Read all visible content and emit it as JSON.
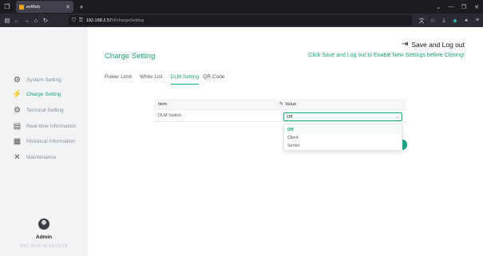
{
  "browser": {
    "tab_title": "evWeb",
    "new_tab": "+",
    "url_host": "192.168.2.57",
    "url_path": "/#/chargeSetting"
  },
  "sidebar": {
    "items": [
      {
        "label": "System Setting",
        "icon": "gear-icon"
      },
      {
        "label": "Charge Setting",
        "icon": "charging-icon"
      },
      {
        "label": "Terminal Setting",
        "icon": "terminal-icon"
      },
      {
        "label": "Real-time Information",
        "icon": "monitor-icon"
      },
      {
        "label": "Historical Information",
        "icon": "history-icon"
      },
      {
        "label": "Maintenance",
        "icon": "tools-icon"
      }
    ],
    "user": "Admin",
    "mac": "MAC:00:0F:8F:F5:CE:6A"
  },
  "header": {
    "title": "Charge Setting",
    "save_logout": "Save and Log out",
    "hint": "Click Save and Log out to Enable New Settings before Closing!"
  },
  "tabs": [
    "Power Limit",
    "White List",
    "DLM Setting",
    "QR Code"
  ],
  "active_tab": "DLM Setting",
  "table": {
    "col_item": "Item",
    "col_value": "Value",
    "rows": [
      {
        "item": "DLM Switch",
        "value": "Off"
      }
    ]
  },
  "dropdown": {
    "options": [
      "Off",
      "Client",
      "Server"
    ],
    "selected": "Off"
  },
  "colors": {
    "accent": "#1aa37e"
  }
}
